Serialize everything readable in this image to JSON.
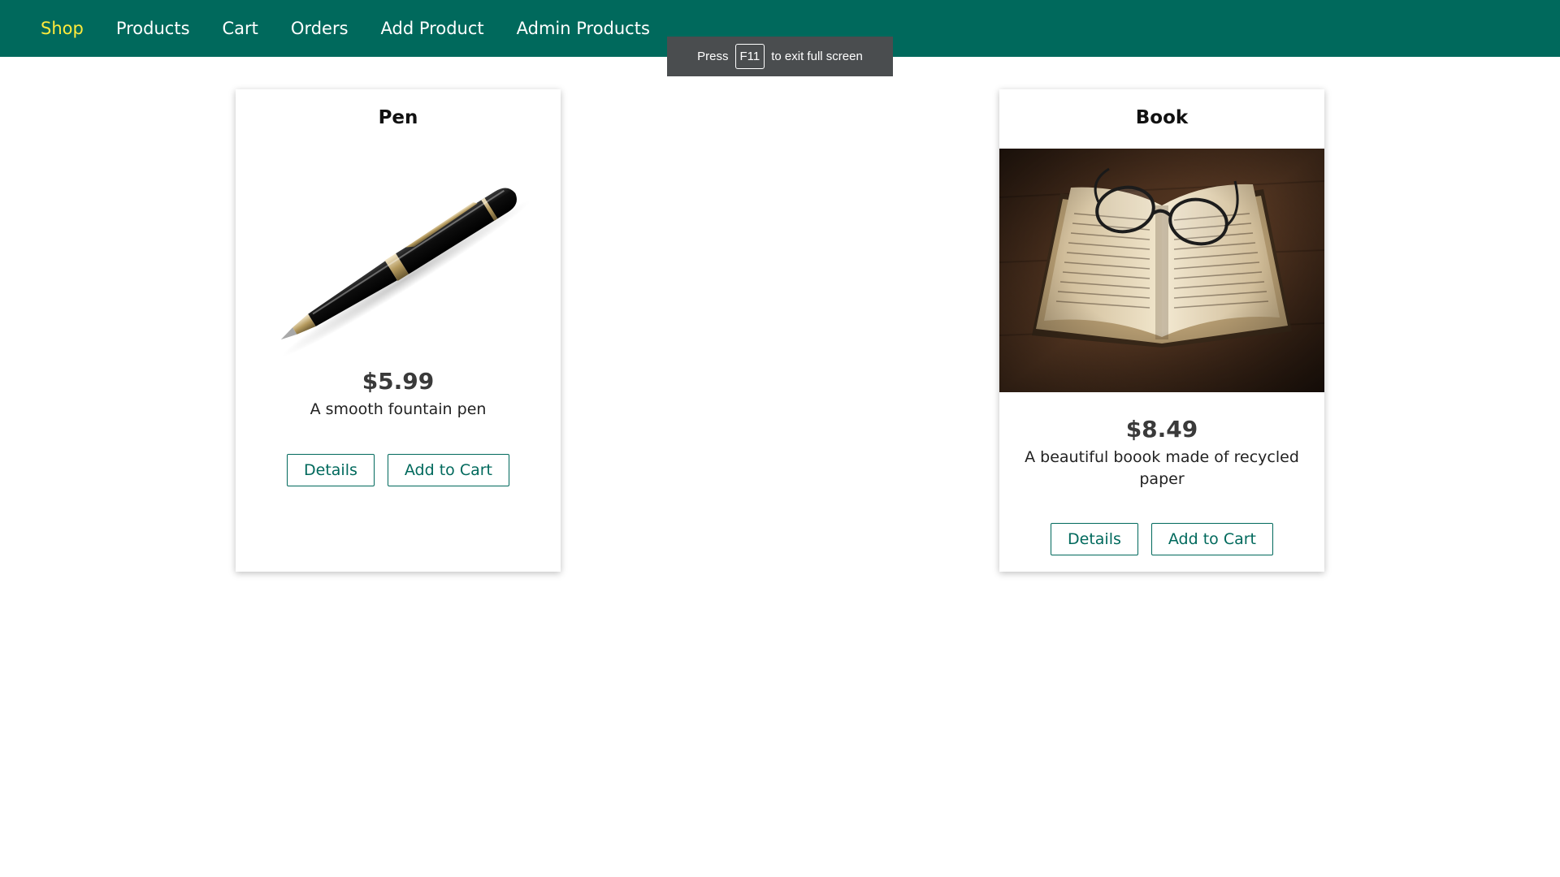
{
  "nav": {
    "items": [
      {
        "label": "Shop",
        "active": true
      },
      {
        "label": "Products",
        "active": false
      },
      {
        "label": "Cart",
        "active": false
      },
      {
        "label": "Orders",
        "active": false
      },
      {
        "label": "Add Product",
        "active": false
      },
      {
        "label": "Admin Products",
        "active": false
      }
    ]
  },
  "fullscreen_notice": {
    "prefix": "Press",
    "key": "F11",
    "suffix": "to exit full screen"
  },
  "products": [
    {
      "title": "Pen",
      "image": "pen-photo",
      "price": "$5.99",
      "description": "A smooth fountain pen",
      "details_label": "Details",
      "add_to_cart_label": "Add to Cart"
    },
    {
      "title": "Book",
      "image": "open-book-with-glasses-photo",
      "price": "$8.49",
      "description": "A beautiful boook made of recycled paper",
      "details_label": "Details",
      "add_to_cart_label": "Add to Cart"
    }
  ],
  "colors": {
    "header": "#00695c",
    "active_nav": "#ffeb3b",
    "button_border": "#00695c"
  }
}
